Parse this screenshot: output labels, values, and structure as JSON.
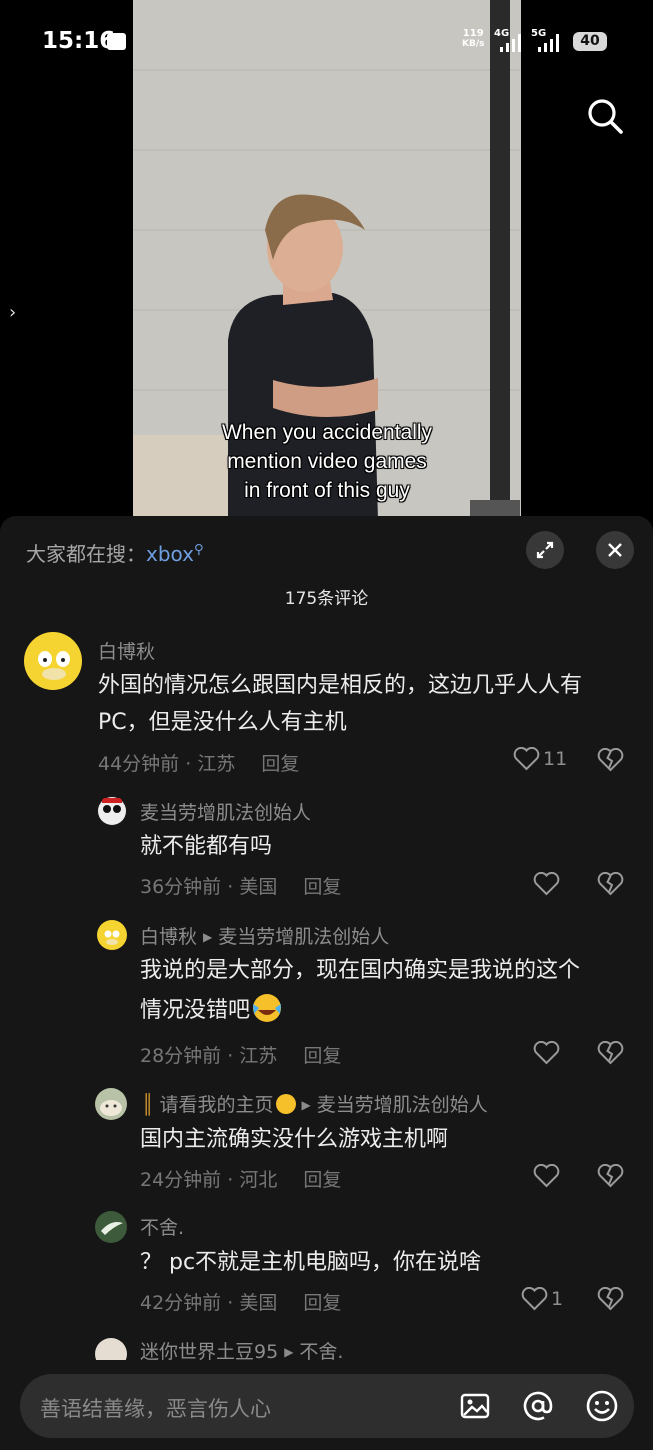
{
  "status_bar": {
    "time": "15:16",
    "net_speed_value": "119",
    "net_speed_unit": "KB/s",
    "signal_1_label": "4G",
    "signal_2_label": "5G",
    "battery": "40"
  },
  "video": {
    "caption_lines": [
      "When you accidentally",
      "mention video games",
      "in front of this guy"
    ]
  },
  "comments_panel": {
    "hot_search_prefix": "大家都在搜：",
    "hot_search_term": "xbox",
    "comment_count": "175条评论",
    "comments": [
      {
        "username": "白博秋",
        "text_lines": [
          "外国的情况怎么跟国内是相反的，这边几乎人人有",
          "PC，但是没什么人有主机"
        ],
        "time": "44分钟前",
        "location": "江苏",
        "reply_label": "回复",
        "likes": "11"
      },
      {
        "username": "麦当劳增肌法创始人",
        "text_lines": [
          "就不能都有吗"
        ],
        "time": "36分钟前",
        "location": "美国",
        "reply_label": "回复",
        "likes": ""
      },
      {
        "username": "白博秋",
        "reply_to": "麦当劳增肌法创始人",
        "text_lines": [
          "我说的是大部分，现在国内确实是我说的这个",
          "情况没错吧"
        ],
        "time": "28分钟前",
        "location": "江苏",
        "reply_label": "回复",
        "likes": ""
      },
      {
        "username": "请看我的主页",
        "reply_to": "麦当劳增肌法创始人",
        "text_lines": [
          "国内主流确实没什么游戏主机啊"
        ],
        "time": "24分钟前",
        "location": "河北",
        "reply_label": "回复",
        "likes": ""
      },
      {
        "username": "不舍.",
        "text_lines": [
          "？ pc不就是主机电脑吗，你在说啥"
        ],
        "time": "42分钟前",
        "location": "美国",
        "reply_label": "回复",
        "likes": "1"
      },
      {
        "username": "迷你世界土豆95",
        "reply_to": "不舍."
      }
    ],
    "input_placeholder": "善语结善缘，恶言伤人心"
  },
  "colors": {
    "sheet_bg": "#161616",
    "link": "#6f9fe0",
    "text": "#ececec",
    "muted": "#777777"
  },
  "icons": [
    "search-icon",
    "expand-icon",
    "close-icon",
    "heart-icon",
    "broken-heart-icon",
    "image-icon",
    "at-icon",
    "emoji-icon"
  ]
}
